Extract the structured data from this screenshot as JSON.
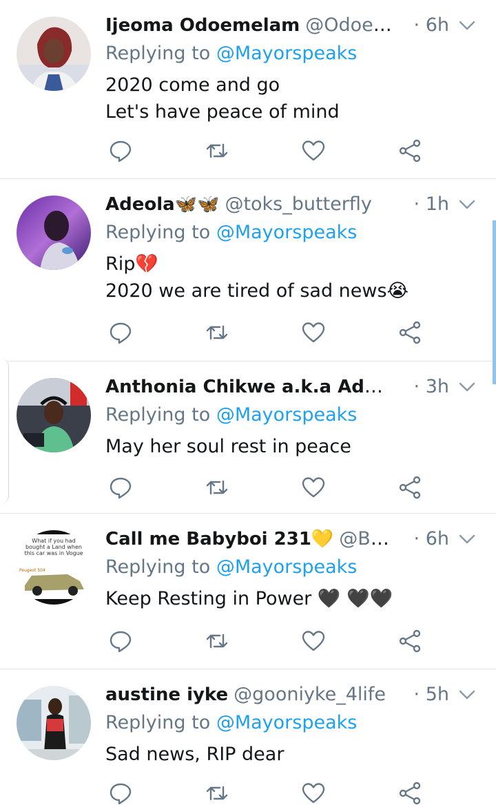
{
  "colors": {
    "text": "#14171a",
    "muted": "#657786",
    "link": "#1da1f2",
    "divider": "#e1e8ed"
  },
  "tweets": [
    {
      "name": "Ijeoma Odoemelam",
      "handle": "@Odoemel…",
      "time": "· 6h",
      "replying_prefix": "Replying to",
      "replying_to": "@Mayorspeaks",
      "lines": [
        "2020 come and go",
        "Let's have peace of mind"
      ]
    },
    {
      "name": "Adeola",
      "name_emoji": "🦋🦋",
      "handle": "@toks_butterfly",
      "time": "· 1h",
      "replying_prefix": "Replying to",
      "replying_to": "@Mayorspeaks",
      "lines": [
        "Rip💔",
        "2020 we are tired of sad news😭"
      ]
    },
    {
      "name": "Anthonia Chikwe a.k.a Ada Ow…",
      "handle": "",
      "time": "· 3h",
      "replying_prefix": "Replying to",
      "replying_to": "@Mayorspeaks",
      "lines": [
        "May her soul rest in peace"
      ]
    },
    {
      "name": "Call me Babyboi 231",
      "name_emoji": "💛",
      "handle": "@Baba…",
      "time": "· 6h",
      "replying_prefix": "Replying to",
      "replying_to": "@Mayorspeaks",
      "lines": [
        "Keep Resting in Power 🖤 🖤🖤"
      ],
      "avatar_text": [
        "What if you had",
        "bought a Land when",
        "this car was in Vogue",
        "Peugeot 504"
      ]
    },
    {
      "name": "austine iyke",
      "handle": "@gooniyke_4life",
      "time": "· 5h",
      "replying_prefix": "Replying to",
      "replying_to": "@Mayorspeaks",
      "lines": [
        "Sad news, RIP dear"
      ]
    }
  ],
  "icons": {
    "reply": "reply-icon",
    "retweet": "retweet-icon",
    "like": "like-icon",
    "share": "share-icon",
    "caret": "chevron-down-icon"
  }
}
